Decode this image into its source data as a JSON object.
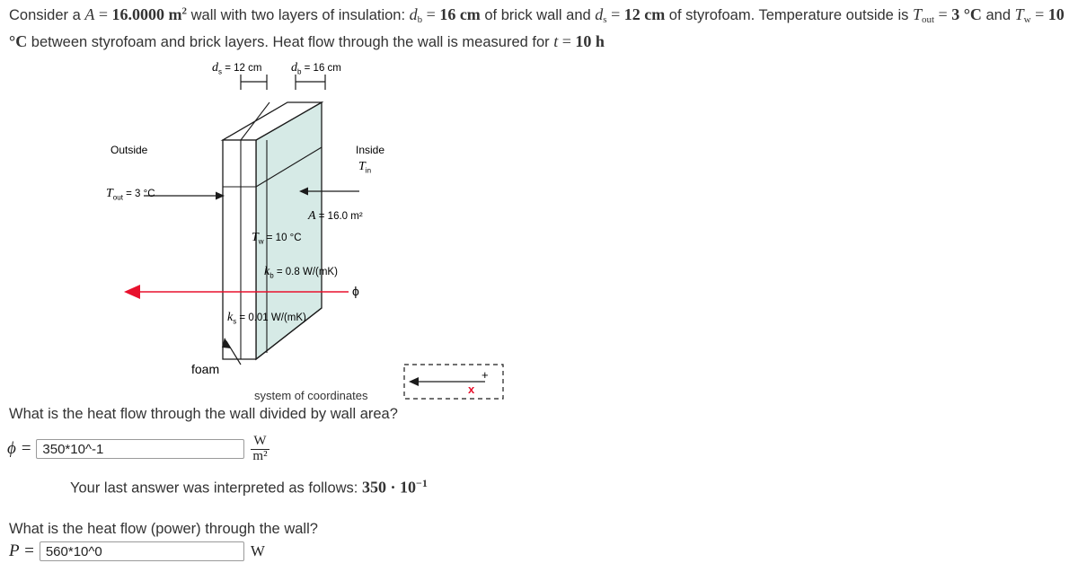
{
  "statement": {
    "line1_pre": "Consider a ",
    "area_sym": "A",
    "eq": " = ",
    "area_val": "16.0000 m",
    "area_exp": "2",
    "line1_mid": " wall with two layers of insulation: ",
    "db_sym": "d",
    "db_sub": "b",
    "db_val": "16 cm",
    "line1_mid2": " of brick wall and ",
    "ds_sym": "d",
    "ds_sub": "s",
    "ds_val": "12 cm",
    "line1_end": " of styrofoam. Temperature outside is",
    "tout_sym": "T",
    "tout_sub": "out",
    "tout_val": "3 °C",
    "line2_and": " and ",
    "tw_sym": "T",
    "tw_sub": "w",
    "tw_val": "10 °C",
    "line2_mid": " between styrofoam and brick layers. Heat flow through the wall is measured for ",
    "t_sym": "t",
    "t_val": "10 h"
  },
  "figure": {
    "dim_s_label": "d",
    "dim_s_sub": "s",
    "dim_s_value": " = 12 cm",
    "dim_b_label": "d",
    "dim_b_sub": "b",
    "dim_b_value": " = 16 cm",
    "outside_label": "Outside",
    "inside_label": "Inside",
    "tin_label": "T",
    "tin_sub": "in",
    "tout_label": "T",
    "tout_sub": "out",
    "tout_value": " = 3 °C",
    "area_label": "A",
    "area_value": " = 16.0 m²",
    "tw_label": "T",
    "tw_sub": "w",
    "tw_value": " = 10 °C",
    "kb_label": "k",
    "kb_sub": "b",
    "kb_value": " = 0.8 W/(mK)",
    "ks_label": "k",
    "ks_sub": "s",
    "ks_value": " = 0.01 W/(mK)",
    "phi_label": "ϕ",
    "foam_label": "foam",
    "coords_label": "system of coordinates",
    "coords_plus": "+",
    "coords_x": "x",
    "wall_fill": "#d6eae6",
    "wall_stroke": "#1b1b1b",
    "phi_arrow_color": "#e8112d"
  },
  "questions": {
    "q1": "What is the heat flow through the wall divided by wall area?",
    "q1_symbol": "ϕ =",
    "q1_value": "350*10^-1",
    "q1_unit_num": "W",
    "q1_unit_den": "m²",
    "interp_pre": "Your last answer was interpreted as follows: ",
    "interp_value": "350 · 10",
    "interp_exp": "−1",
    "q2": "What is the heat flow (power) through the wall?",
    "q2_symbol": "P =",
    "q2_value": "560*10^0",
    "q2_unit": "W"
  }
}
